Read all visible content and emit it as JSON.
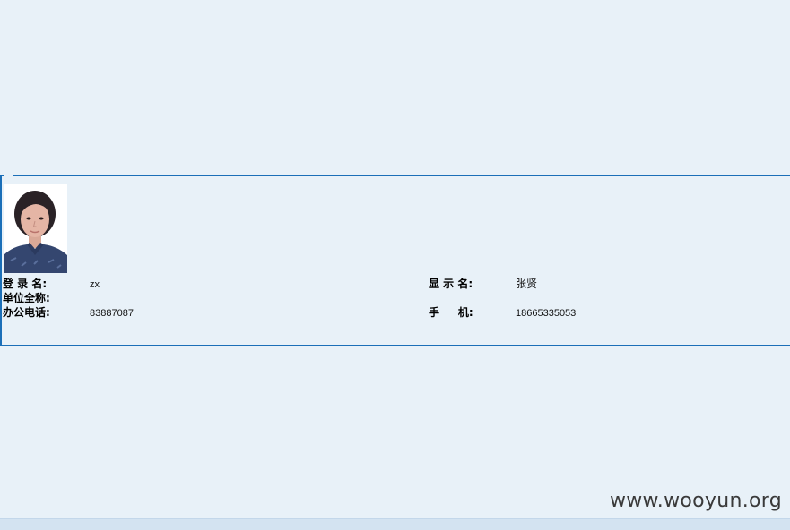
{
  "profile": {
    "photo_alt": "user-photo",
    "fields": {
      "login_label": "登 录 名:",
      "login_value": "zx",
      "display_label": "显 示 名:",
      "display_value": "张贤",
      "unit_label": "单位全称:",
      "unit_value": "",
      "office_phone_label": "办公电话:",
      "office_phone_value": "83887087",
      "mobile_label": "手     机:",
      "mobile_value": "18665335053"
    }
  },
  "watermark": "www.wooyun.org",
  "colors": {
    "background": "#e8f1f8",
    "border": "#1b6fb8"
  }
}
